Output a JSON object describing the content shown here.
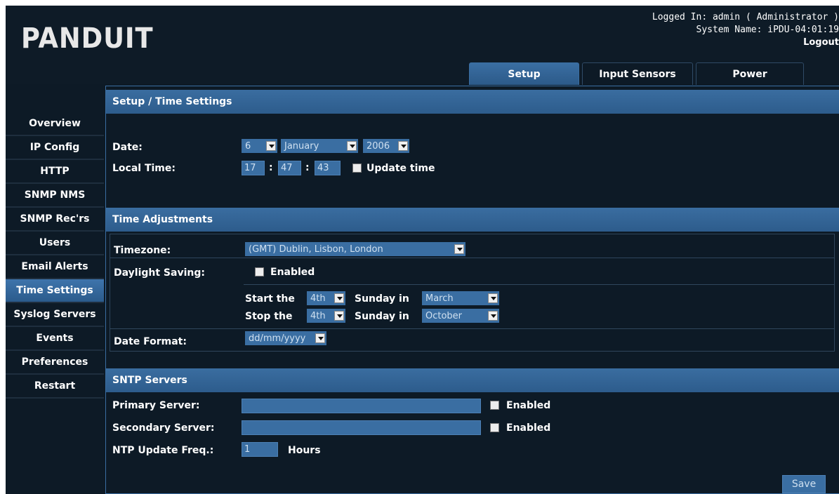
{
  "header": {
    "logo": "PANDUIT",
    "logged_in": "Logged In: admin ( Administrator )",
    "system_name": "System Name: iPDU-04:01:19",
    "logout": "Logout"
  },
  "tabs": [
    {
      "label": "Setup",
      "active": true
    },
    {
      "label": "Input Sensors",
      "active": false
    },
    {
      "label": "Power",
      "active": false
    }
  ],
  "sidebar": {
    "items": [
      {
        "label": "Overview"
      },
      {
        "label": "IP Config"
      },
      {
        "label": "HTTP"
      },
      {
        "label": "SNMP NMS"
      },
      {
        "label": "SNMP Rec'rs"
      },
      {
        "label": "Users"
      },
      {
        "label": "Email Alerts"
      },
      {
        "label": "Time Settings",
        "active": true
      },
      {
        "label": "Syslog Servers"
      },
      {
        "label": "Events"
      },
      {
        "label": "Preferences"
      },
      {
        "label": "Restart"
      }
    ]
  },
  "time_settings": {
    "title": "Setup / Time Settings",
    "date_label": "Date:",
    "day": "6",
    "month": "January",
    "year": "2006",
    "local_time_label": "Local Time:",
    "hour": "17",
    "minute": "47",
    "second": "43",
    "update_time_label": "Update time"
  },
  "adjustments": {
    "title": "Time Adjustments",
    "timezone_label": "Timezone:",
    "timezone": "(GMT) Dublin, Lisbon, London",
    "dst_label": "Daylight Saving:",
    "dst_enabled_label": "Enabled",
    "start_label": "Start the",
    "start_week": "4th",
    "start_day_label": "Sunday in",
    "start_month": "March",
    "stop_label": "Stop the",
    "stop_week": "4th",
    "stop_day_label": "Sunday in",
    "stop_month": "October",
    "date_format_label": "Date Format:",
    "date_format": "dd/mm/yyyy"
  },
  "sntp": {
    "title": "SNTP Servers",
    "primary_label": "Primary Server:",
    "primary_value": "",
    "primary_enabled": "Enabled",
    "secondary_label": "Secondary Server:",
    "secondary_value": "",
    "secondary_enabled": "Enabled",
    "freq_label": "NTP Update Freq.:",
    "freq_value": "1",
    "freq_unit": "Hours",
    "save": "Save"
  }
}
